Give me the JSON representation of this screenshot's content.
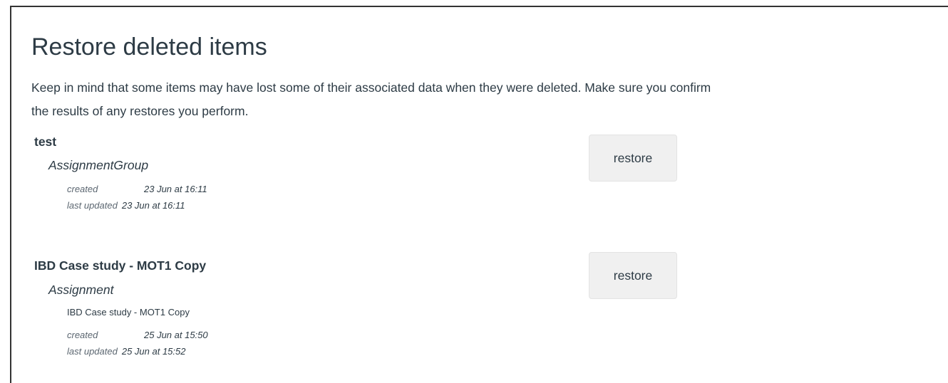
{
  "page": {
    "title": "Restore deleted items",
    "intro_line1": "Keep in mind that some items may have lost some of their associated data when they were deleted. Make sure you confirm",
    "intro_line2": "the results of any restores you perform."
  },
  "items": [
    {
      "title": "test",
      "type": "AssignmentGroup",
      "description": "",
      "created_label": "created",
      "created_value": "23 Jun at 16:11",
      "updated_label": "last updated",
      "updated_value": "23 Jun at 16:11",
      "restore_label": "restore"
    },
    {
      "title": "IBD Case study - MOT1 Copy",
      "type": "Assignment",
      "description": "IBD Case study - MOT1 Copy",
      "created_label": "created",
      "created_value": "25 Jun at 15:50",
      "updated_label": "last updated",
      "updated_value": "25 Jun at 15:52",
      "restore_label": "restore"
    }
  ]
}
